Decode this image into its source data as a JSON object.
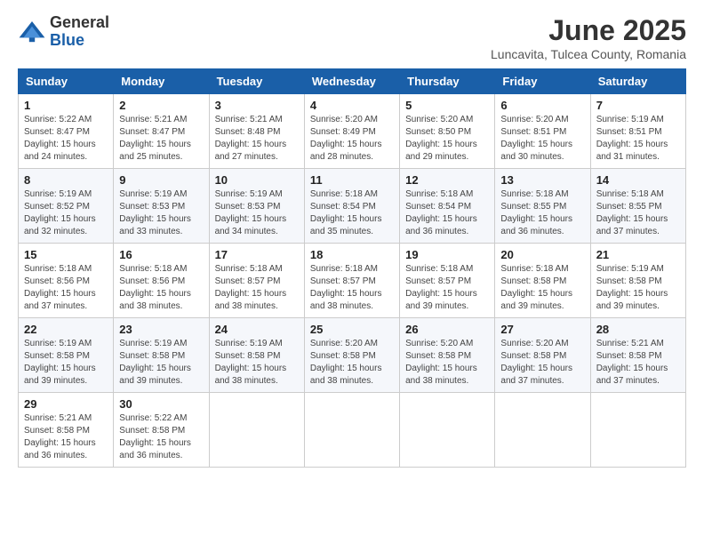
{
  "logo": {
    "general": "General",
    "blue": "Blue"
  },
  "title": "June 2025",
  "location": "Luncavita, Tulcea County, Romania",
  "days_of_week": [
    "Sunday",
    "Monday",
    "Tuesday",
    "Wednesday",
    "Thursday",
    "Friday",
    "Saturday"
  ],
  "weeks": [
    [
      {
        "day": "1",
        "info": "Sunrise: 5:22 AM\nSunset: 8:47 PM\nDaylight: 15 hours\nand 24 minutes."
      },
      {
        "day": "2",
        "info": "Sunrise: 5:21 AM\nSunset: 8:47 PM\nDaylight: 15 hours\nand 25 minutes."
      },
      {
        "day": "3",
        "info": "Sunrise: 5:21 AM\nSunset: 8:48 PM\nDaylight: 15 hours\nand 27 minutes."
      },
      {
        "day": "4",
        "info": "Sunrise: 5:20 AM\nSunset: 8:49 PM\nDaylight: 15 hours\nand 28 minutes."
      },
      {
        "day": "5",
        "info": "Sunrise: 5:20 AM\nSunset: 8:50 PM\nDaylight: 15 hours\nand 29 minutes."
      },
      {
        "day": "6",
        "info": "Sunrise: 5:20 AM\nSunset: 8:51 PM\nDaylight: 15 hours\nand 30 minutes."
      },
      {
        "day": "7",
        "info": "Sunrise: 5:19 AM\nSunset: 8:51 PM\nDaylight: 15 hours\nand 31 minutes."
      }
    ],
    [
      {
        "day": "8",
        "info": "Sunrise: 5:19 AM\nSunset: 8:52 PM\nDaylight: 15 hours\nand 32 minutes."
      },
      {
        "day": "9",
        "info": "Sunrise: 5:19 AM\nSunset: 8:53 PM\nDaylight: 15 hours\nand 33 minutes."
      },
      {
        "day": "10",
        "info": "Sunrise: 5:19 AM\nSunset: 8:53 PM\nDaylight: 15 hours\nand 34 minutes."
      },
      {
        "day": "11",
        "info": "Sunrise: 5:18 AM\nSunset: 8:54 PM\nDaylight: 15 hours\nand 35 minutes."
      },
      {
        "day": "12",
        "info": "Sunrise: 5:18 AM\nSunset: 8:54 PM\nDaylight: 15 hours\nand 36 minutes."
      },
      {
        "day": "13",
        "info": "Sunrise: 5:18 AM\nSunset: 8:55 PM\nDaylight: 15 hours\nand 36 minutes."
      },
      {
        "day": "14",
        "info": "Sunrise: 5:18 AM\nSunset: 8:55 PM\nDaylight: 15 hours\nand 37 minutes."
      }
    ],
    [
      {
        "day": "15",
        "info": "Sunrise: 5:18 AM\nSunset: 8:56 PM\nDaylight: 15 hours\nand 37 minutes."
      },
      {
        "day": "16",
        "info": "Sunrise: 5:18 AM\nSunset: 8:56 PM\nDaylight: 15 hours\nand 38 minutes."
      },
      {
        "day": "17",
        "info": "Sunrise: 5:18 AM\nSunset: 8:57 PM\nDaylight: 15 hours\nand 38 minutes."
      },
      {
        "day": "18",
        "info": "Sunrise: 5:18 AM\nSunset: 8:57 PM\nDaylight: 15 hours\nand 38 minutes."
      },
      {
        "day": "19",
        "info": "Sunrise: 5:18 AM\nSunset: 8:57 PM\nDaylight: 15 hours\nand 39 minutes."
      },
      {
        "day": "20",
        "info": "Sunrise: 5:18 AM\nSunset: 8:58 PM\nDaylight: 15 hours\nand 39 minutes."
      },
      {
        "day": "21",
        "info": "Sunrise: 5:19 AM\nSunset: 8:58 PM\nDaylight: 15 hours\nand 39 minutes."
      }
    ],
    [
      {
        "day": "22",
        "info": "Sunrise: 5:19 AM\nSunset: 8:58 PM\nDaylight: 15 hours\nand 39 minutes."
      },
      {
        "day": "23",
        "info": "Sunrise: 5:19 AM\nSunset: 8:58 PM\nDaylight: 15 hours\nand 39 minutes."
      },
      {
        "day": "24",
        "info": "Sunrise: 5:19 AM\nSunset: 8:58 PM\nDaylight: 15 hours\nand 38 minutes."
      },
      {
        "day": "25",
        "info": "Sunrise: 5:20 AM\nSunset: 8:58 PM\nDaylight: 15 hours\nand 38 minutes."
      },
      {
        "day": "26",
        "info": "Sunrise: 5:20 AM\nSunset: 8:58 PM\nDaylight: 15 hours\nand 38 minutes."
      },
      {
        "day": "27",
        "info": "Sunrise: 5:20 AM\nSunset: 8:58 PM\nDaylight: 15 hours\nand 37 minutes."
      },
      {
        "day": "28",
        "info": "Sunrise: 5:21 AM\nSunset: 8:58 PM\nDaylight: 15 hours\nand 37 minutes."
      }
    ],
    [
      {
        "day": "29",
        "info": "Sunrise: 5:21 AM\nSunset: 8:58 PM\nDaylight: 15 hours\nand 36 minutes."
      },
      {
        "day": "30",
        "info": "Sunrise: 5:22 AM\nSunset: 8:58 PM\nDaylight: 15 hours\nand 36 minutes."
      },
      {
        "day": "",
        "info": ""
      },
      {
        "day": "",
        "info": ""
      },
      {
        "day": "",
        "info": ""
      },
      {
        "day": "",
        "info": ""
      },
      {
        "day": "",
        "info": ""
      }
    ]
  ]
}
